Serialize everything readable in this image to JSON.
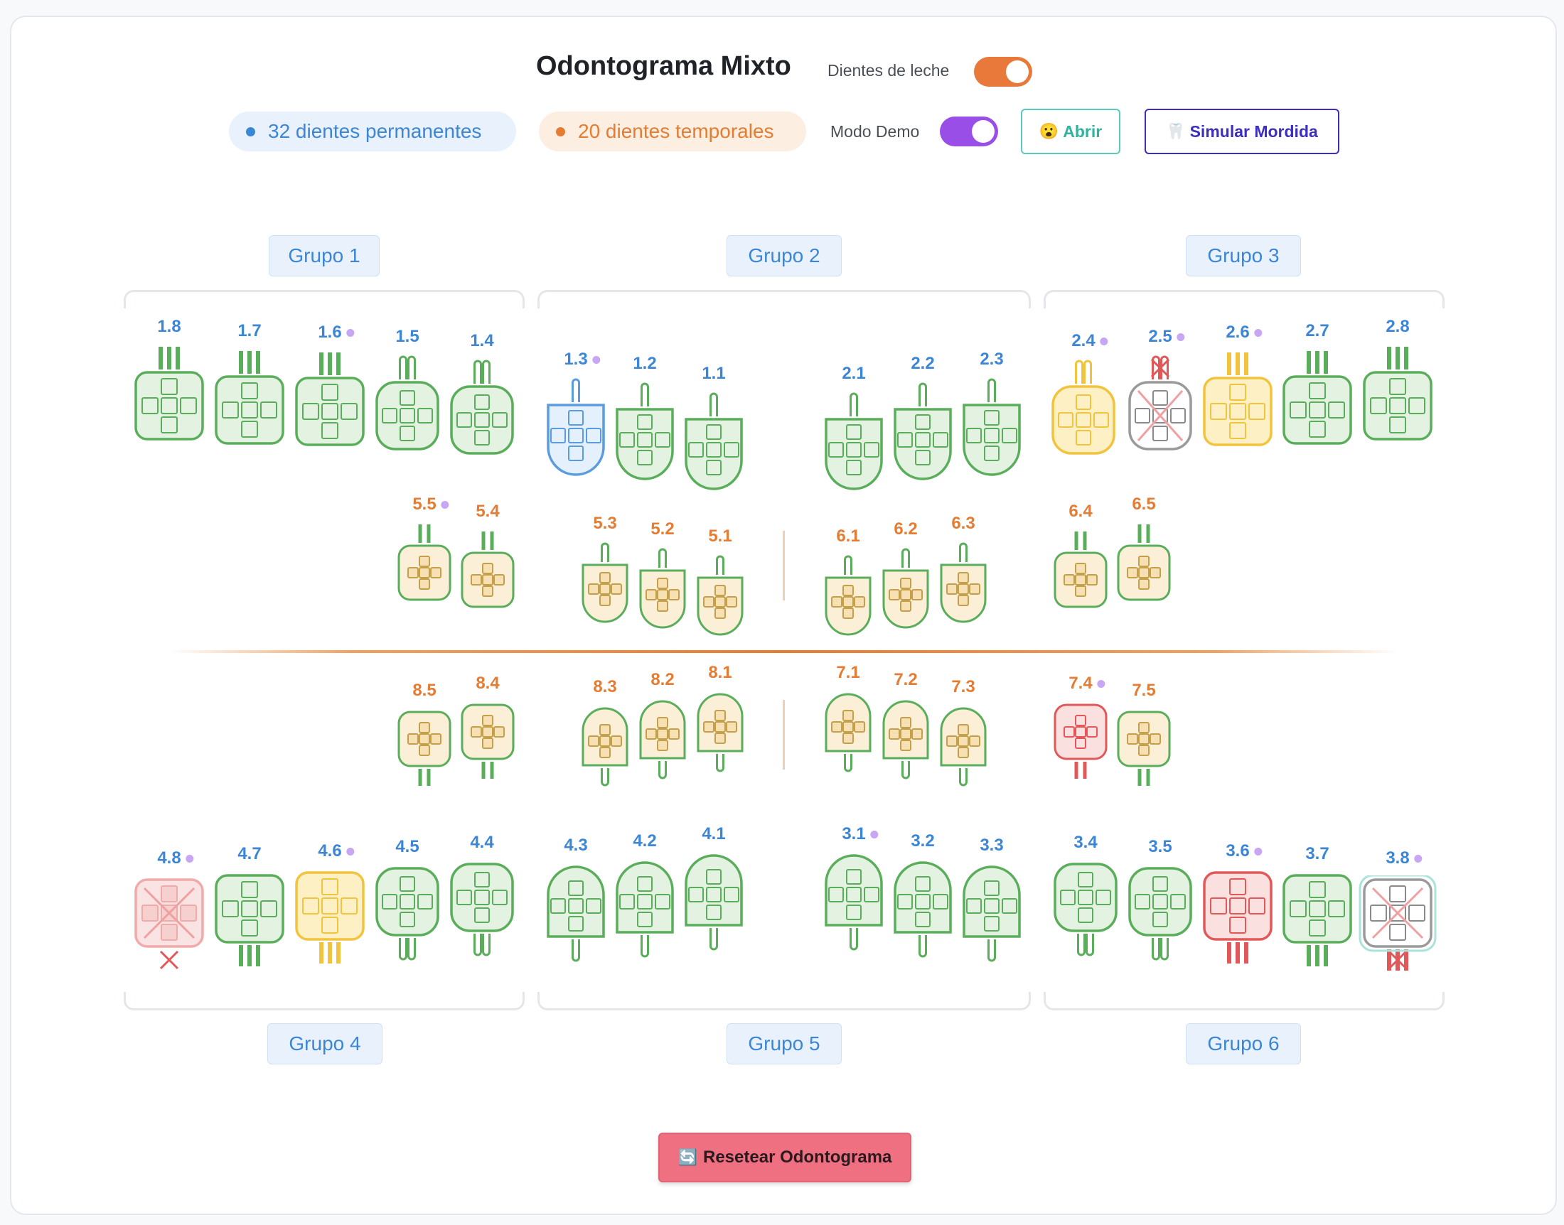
{
  "header": {
    "title": "Odontograma Mixto",
    "dientes_de_leche_label": "Dientes de leche",
    "dientes_de_leche_on": true,
    "permanentes_badge": "32 dientes permanentes",
    "temporales_badge": "20 dientes temporales",
    "modo_demo_label": "Modo Demo",
    "modo_demo_on": true,
    "abrir_icon": "surprised-face-icon",
    "abrir_label": "Abrir",
    "simular_icon": "tooth-icon",
    "simular_label": "Simular Mordida"
  },
  "groups": {
    "g1": "Grupo 1",
    "g2": "Grupo 2",
    "g3": "Grupo 3",
    "g4": "Grupo 4",
    "g5": "Grupo 5",
    "g6": "Grupo 6"
  },
  "reset": {
    "icon": "refresh-icon",
    "label": "Resetear Odontograma"
  },
  "colors": {
    "permanent_label": "#3c86d6",
    "temporary_label": "#e47d33",
    "healthy_stroke": "#5aad5a",
    "healthy_fill": "#e3f2e1",
    "temporary_fill": "#fbefd8",
    "caries_stroke": "#f2c33c",
    "caries_fill": "#fdf0c4",
    "restoration_stroke": "#e25858",
    "restoration_fill": "#fbe0e0",
    "selected_stroke": "#5b9be0",
    "selected_fill": "#e4f0fc",
    "missing_stroke": "#9a9a9a",
    "extracted_stroke": "#f0aaaa",
    "demo_marker": "#c7a6f3"
  },
  "teeth": {
    "upper_permanent": [
      {
        "id": "1.8",
        "status": "healthy",
        "type": "molar",
        "roots": 3,
        "marked": false
      },
      {
        "id": "1.7",
        "status": "healthy",
        "type": "molar",
        "roots": 3,
        "marked": false
      },
      {
        "id": "1.6",
        "status": "healthy",
        "type": "molar",
        "roots": 3,
        "marked": true
      },
      {
        "id": "1.5",
        "status": "healthy",
        "type": "premolar",
        "roots": 2,
        "marked": false
      },
      {
        "id": "1.4",
        "status": "healthy",
        "type": "premolar",
        "roots": 2,
        "marked": false
      },
      {
        "id": "1.3",
        "status": "selected",
        "type": "anterior",
        "roots": 1,
        "marked": true
      },
      {
        "id": "1.2",
        "status": "healthy",
        "type": "anterior",
        "roots": 1,
        "marked": false
      },
      {
        "id": "1.1",
        "status": "healthy",
        "type": "anterior",
        "roots": 1,
        "marked": false
      },
      {
        "id": "2.1",
        "status": "healthy",
        "type": "anterior",
        "roots": 1,
        "marked": false
      },
      {
        "id": "2.2",
        "status": "healthy",
        "type": "anterior",
        "roots": 1,
        "marked": false
      },
      {
        "id": "2.3",
        "status": "healthy",
        "type": "anterior",
        "roots": 1,
        "marked": false
      },
      {
        "id": "2.4",
        "status": "caries",
        "type": "premolar",
        "roots": 2,
        "marked": true
      },
      {
        "id": "2.5",
        "status": "missing",
        "type": "premolar",
        "roots": 2,
        "marked": true
      },
      {
        "id": "2.6",
        "status": "caries",
        "type": "molar",
        "roots": 3,
        "marked": true
      },
      {
        "id": "2.7",
        "status": "healthy",
        "type": "molar",
        "roots": 3,
        "marked": false
      },
      {
        "id": "2.8",
        "status": "healthy",
        "type": "molar",
        "roots": 3,
        "marked": false
      }
    ],
    "upper_temporary": [
      {
        "id": "5.5",
        "status": "healthy",
        "type": "molar",
        "roots": 2,
        "marked": true
      },
      {
        "id": "5.4",
        "status": "healthy",
        "type": "molar",
        "roots": 2,
        "marked": false
      },
      {
        "id": "5.3",
        "status": "healthy",
        "type": "anterior",
        "roots": 1,
        "marked": false
      },
      {
        "id": "5.2",
        "status": "healthy",
        "type": "anterior",
        "roots": 1,
        "marked": false
      },
      {
        "id": "5.1",
        "status": "healthy",
        "type": "anterior",
        "roots": 1,
        "marked": false
      },
      {
        "id": "6.1",
        "status": "healthy",
        "type": "anterior",
        "roots": 1,
        "marked": false
      },
      {
        "id": "6.2",
        "status": "healthy",
        "type": "anterior",
        "roots": 1,
        "marked": false
      },
      {
        "id": "6.3",
        "status": "healthy",
        "type": "anterior",
        "roots": 1,
        "marked": false
      },
      {
        "id": "6.4",
        "status": "healthy",
        "type": "molar",
        "roots": 2,
        "marked": false
      },
      {
        "id": "6.5",
        "status": "healthy",
        "type": "molar",
        "roots": 2,
        "marked": false
      }
    ],
    "lower_temporary": [
      {
        "id": "8.5",
        "status": "healthy",
        "type": "molar",
        "roots": 2,
        "marked": false
      },
      {
        "id": "8.4",
        "status": "healthy",
        "type": "molar",
        "roots": 2,
        "marked": false
      },
      {
        "id": "8.3",
        "status": "healthy",
        "type": "anterior",
        "roots": 1,
        "marked": false
      },
      {
        "id": "8.2",
        "status": "healthy",
        "type": "anterior",
        "roots": 1,
        "marked": false
      },
      {
        "id": "8.1",
        "status": "healthy",
        "type": "anterior",
        "roots": 1,
        "marked": false
      },
      {
        "id": "7.1",
        "status": "healthy",
        "type": "anterior",
        "roots": 1,
        "marked": false
      },
      {
        "id": "7.2",
        "status": "healthy",
        "type": "anterior",
        "roots": 1,
        "marked": false
      },
      {
        "id": "7.3",
        "status": "healthy",
        "type": "anterior",
        "roots": 1,
        "marked": false
      },
      {
        "id": "7.4",
        "status": "restoration",
        "type": "molar",
        "roots": 2,
        "marked": true
      },
      {
        "id": "7.5",
        "status": "healthy",
        "type": "molar",
        "roots": 2,
        "marked": false
      }
    ],
    "lower_permanent": [
      {
        "id": "4.8",
        "status": "extracted",
        "type": "molar",
        "roots": 0,
        "marked": true
      },
      {
        "id": "4.7",
        "status": "healthy",
        "type": "molar",
        "roots": 3,
        "marked": false
      },
      {
        "id": "4.6",
        "status": "caries",
        "type": "molar",
        "roots": 3,
        "marked": true
      },
      {
        "id": "4.5",
        "status": "healthy",
        "type": "premolar",
        "roots": 2,
        "marked": false
      },
      {
        "id": "4.4",
        "status": "healthy",
        "type": "premolar",
        "roots": 2,
        "marked": false
      },
      {
        "id": "4.3",
        "status": "healthy",
        "type": "anterior",
        "roots": 1,
        "marked": false
      },
      {
        "id": "4.2",
        "status": "healthy",
        "type": "anterior",
        "roots": 1,
        "marked": false
      },
      {
        "id": "4.1",
        "status": "healthy",
        "type": "anterior",
        "roots": 1,
        "marked": false
      },
      {
        "id": "3.1",
        "status": "healthy",
        "type": "anterior",
        "roots": 1,
        "marked": true
      },
      {
        "id": "3.2",
        "status": "healthy",
        "type": "anterior",
        "roots": 1,
        "marked": false
      },
      {
        "id": "3.3",
        "status": "healthy",
        "type": "anterior",
        "roots": 1,
        "marked": false
      },
      {
        "id": "3.4",
        "status": "healthy",
        "type": "premolar",
        "roots": 2,
        "marked": false
      },
      {
        "id": "3.5",
        "status": "healthy",
        "type": "premolar",
        "roots": 2,
        "marked": false
      },
      {
        "id": "3.6",
        "status": "restoration",
        "type": "molar",
        "roots": 3,
        "marked": true
      },
      {
        "id": "3.7",
        "status": "healthy",
        "type": "molar",
        "roots": 3,
        "marked": false
      },
      {
        "id": "3.8",
        "status": "missing-highlight",
        "type": "molar",
        "roots": 3,
        "marked": true
      }
    ]
  }
}
